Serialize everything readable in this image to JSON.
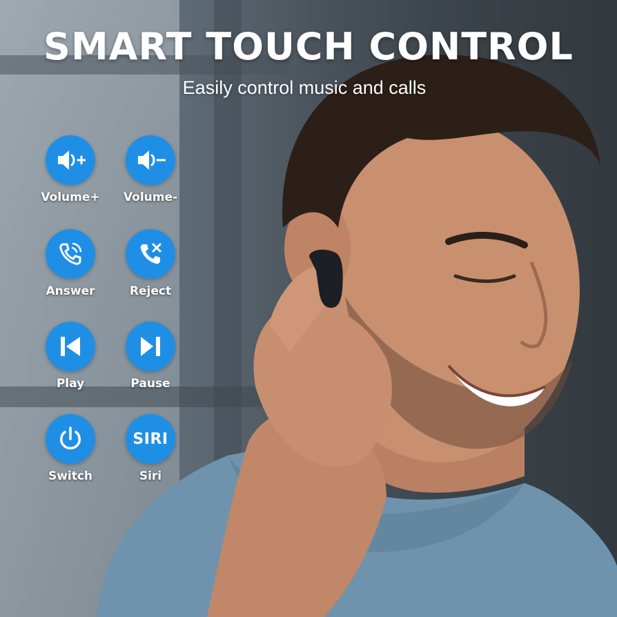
{
  "header": {
    "title": "SMART TOUCH CONTROL",
    "subtitle": "Easily control music and calls"
  },
  "controls": [
    {
      "label": "Volume+",
      "icon": "volume-up-icon"
    },
    {
      "label": "Volume-",
      "icon": "volume-down-icon"
    },
    {
      "label": "Answer",
      "icon": "phone-answer-icon"
    },
    {
      "label": "Reject",
      "icon": "phone-reject-icon"
    },
    {
      "label": "Play",
      "icon": "previous-track-icon"
    },
    {
      "label": "Pause",
      "icon": "play-pause-icon"
    },
    {
      "label": "Switch",
      "icon": "power-icon"
    },
    {
      "label": "Siri",
      "icon": "siri-icon",
      "icon_text": "SIRI"
    }
  ],
  "colors": {
    "accent": "#1f8fe6",
    "text": "#ffffff",
    "shirt": "#6f93ad",
    "earbud": "#1c1f23"
  }
}
